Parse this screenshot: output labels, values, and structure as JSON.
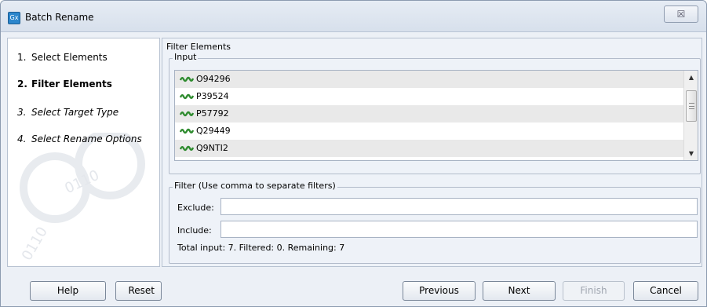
{
  "window": {
    "title": "Batch Rename",
    "app_icon_label": "Gx",
    "close_glyph": "☒"
  },
  "steps": [
    {
      "number": "1.",
      "label": "Select Elements",
      "state": "done"
    },
    {
      "number": "2.",
      "label": "Filter Elements",
      "state": "active"
    },
    {
      "number": "3.",
      "label": "Select Target Type",
      "state": "future"
    },
    {
      "number": "4.",
      "label": "Select Rename Options",
      "state": "future"
    }
  ],
  "panel": {
    "title": "Filter Elements",
    "input_group_label": "Input",
    "input_items": [
      "O94296",
      "P39524",
      "P57792",
      "Q29449",
      "Q9NTI2"
    ],
    "filter_group_label": "Filter (Use comma to separate filters)",
    "exclude_label": "Exclude:",
    "exclude_value": "",
    "include_label": "Include:",
    "include_value": "",
    "summary": "Total input: 7. Filtered: 0. Remaining: 7"
  },
  "buttons": {
    "help": "Help",
    "reset": "Reset",
    "previous": "Previous",
    "next": "Next",
    "finish": "Finish",
    "cancel": "Cancel"
  },
  "icons": {
    "sequence": "protein-sequence-icon",
    "sequence_color": "#2e8b2e"
  }
}
